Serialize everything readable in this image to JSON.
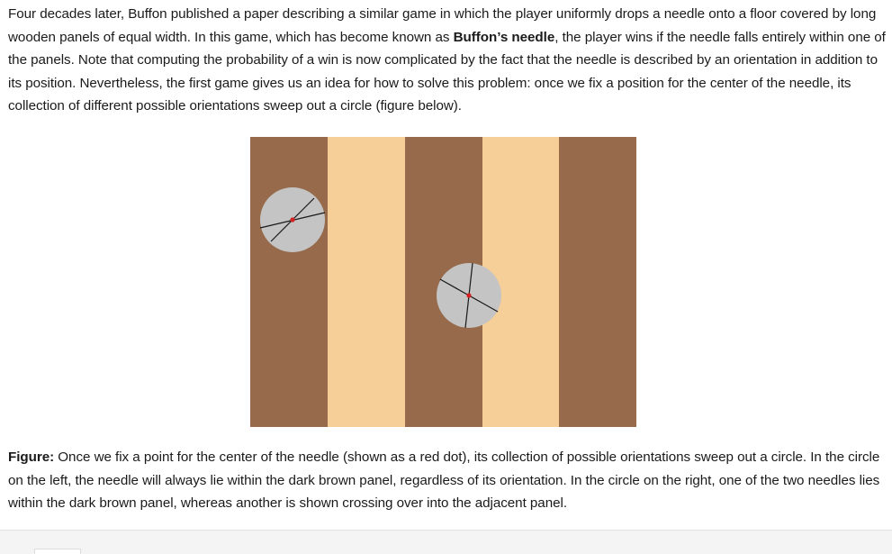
{
  "paragraph": {
    "text_before_bold": "Four decades later, Buffon published a paper describing a similar game in which the player uniformly drops a needle onto a floor covered by long wooden panels of equal width. In this game, which has become known as ",
    "bold_term": "Buffon’s needle",
    "text_after_bold": ", the player wins if the needle falls entirely within one of the panels. Note that computing the probability of a win is now complicated by the fact that the needle is described by an orientation in addition to its position. Nevertheless, the first game gives us an idea for how to solve this problem: once we fix a position for the center of the needle, its collection of different possible orientations sweep out a circle (figure below)."
  },
  "figure": {
    "colors": {
      "dark_panel": "#966a4a",
      "light_panel": "#f5cf97",
      "circle_fill": "#c4c4c4",
      "needle": "#1a1a1a",
      "center_dot": "#d42020"
    }
  },
  "caption": {
    "label": "Figure:",
    "text": " Once we fix a point for the center of the needle (shown as a red dot), its collection of possible orientations sweep out a circle. In the circle on the left, the needle will always lie within the dark brown panel, regardless of its orientation. In the circle on the right, one of the two needles lies within the dark brown panel, whereas another is shown crossing over into the adjacent panel."
  }
}
